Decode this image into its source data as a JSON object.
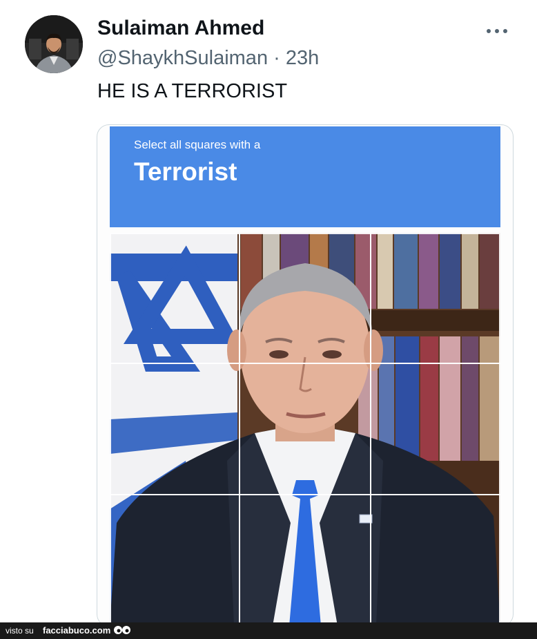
{
  "author": {
    "name": "Sulaiman Ahmed",
    "handle": "@ShaykhSulaiman",
    "separator": "·",
    "time": "23h"
  },
  "more_icon": "more-horizontal-icon",
  "tweet_text": "HE IS A TERRORIST",
  "captcha": {
    "instruction": "Select all squares with a",
    "target": "Terrorist",
    "header_color": "#4a8ae6",
    "grid": {
      "rows": 3,
      "cols": 3
    }
  },
  "footer": {
    "visto": "visto su",
    "site": "facciabuco.com",
    "icon": "eyes-icon"
  }
}
